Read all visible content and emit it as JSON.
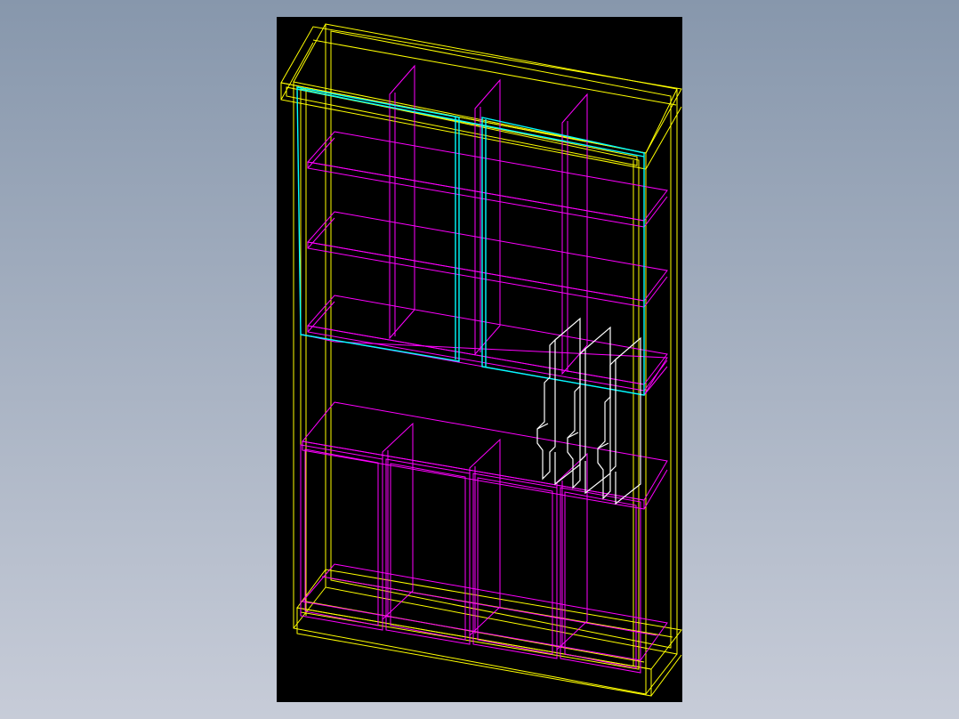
{
  "app": {
    "background_top": "#8797ac",
    "background_bottom": "#c7ccd8"
  },
  "viewport": {
    "background": "#000000"
  },
  "layers": [
    {
      "name": "carcass",
      "color": "#ffff00"
    },
    {
      "name": "shelves-and-partitions",
      "color": "#ff00ff"
    },
    {
      "name": "sliding-glass-doors",
      "color": "#00ffff"
    },
    {
      "name": "hanging-hardware",
      "color": "#ffffff"
    }
  ],
  "model": {
    "upper_shelf_count": 4,
    "upper_partition_count": 3,
    "lower_compartment_count": 4,
    "sliding_door_count": 2,
    "hanging_bracket_count": 3
  }
}
